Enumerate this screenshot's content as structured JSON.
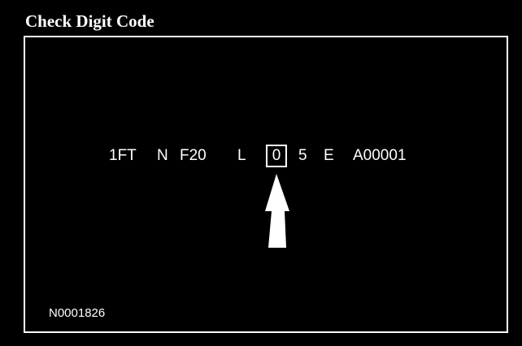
{
  "title": "Check Digit Code",
  "vin_segments": [
    "1FT",
    "N",
    "F20",
    "L",
    "0",
    "5",
    "E",
    "A00001"
  ],
  "highlighted_index": 4,
  "figure_code": "N0001826",
  "colors": {
    "background": "#000000",
    "foreground": "#ffffff"
  },
  "pointer": "up-arrow-icon"
}
